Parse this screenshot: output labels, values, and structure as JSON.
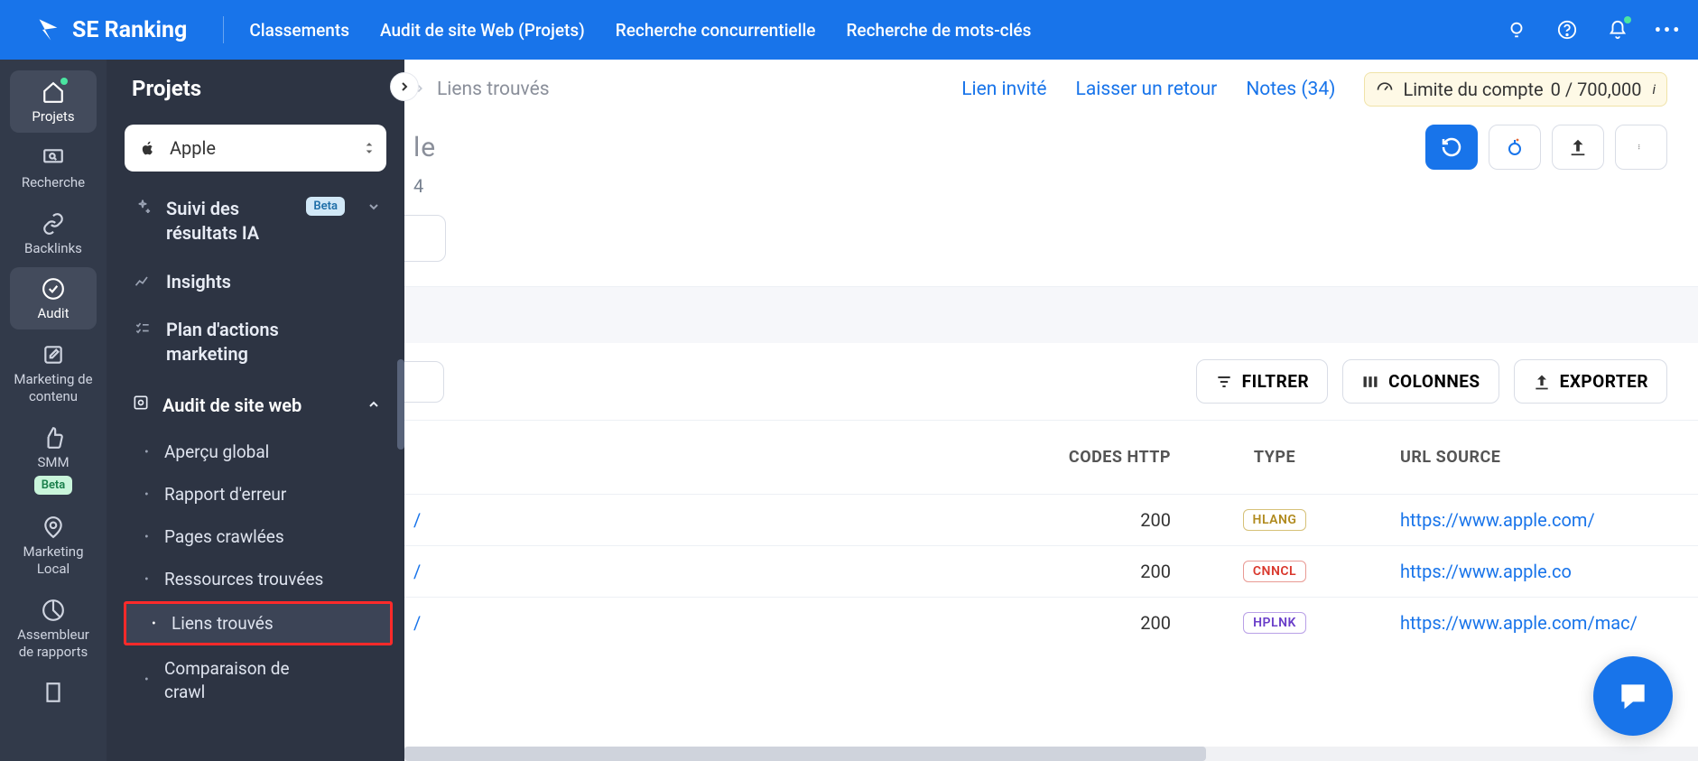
{
  "brand": "SE Ranking",
  "top_nav": {
    "items": [
      "Classements",
      "Audit de site Web (Projets)",
      "Recherche concurrentielle",
      "Recherche de mots-clés"
    ]
  },
  "icon_rail": {
    "items": [
      {
        "label": "Projets",
        "icon": "home-icon",
        "active": true,
        "green_dot": true
      },
      {
        "label": "Recherche",
        "icon": "monitor-search-icon"
      },
      {
        "label": "Backlinks",
        "icon": "link-icon"
      },
      {
        "label": "Audit",
        "icon": "check-circle-icon",
        "active": true
      },
      {
        "label": "Marketing de contenu",
        "icon": "edit-icon"
      },
      {
        "label": "SMM",
        "icon": "thumb-up-icon",
        "beta": true
      },
      {
        "label": "Marketing Local",
        "icon": "pin-icon"
      },
      {
        "label": "Assembleur de rapports",
        "icon": "pie-icon"
      }
    ],
    "beta_label": "Beta"
  },
  "side_panel": {
    "title": "Projets",
    "project_name": "Apple",
    "menu": {
      "ai_results": {
        "line1": "Suivi des",
        "line2": "résultats IA",
        "badge": "Beta"
      },
      "insights": "Insights",
      "marketing_plan": {
        "line1": "Plan d'actions",
        "line2": "marketing"
      },
      "section": "Audit de site web",
      "sub": [
        {
          "label": "Aperçu global"
        },
        {
          "label": "Rapport d'erreur"
        },
        {
          "label": "Pages crawlées"
        },
        {
          "label": "Ressources trouvées"
        },
        {
          "label": "Liens trouvés",
          "active": true,
          "highlighted": true
        },
        {
          "label": "Comparaison de crawl",
          "multi": true,
          "line1": "Comparaison de",
          "line2": "crawl"
        }
      ]
    }
  },
  "main": {
    "breadcrumb": "Liens trouvés",
    "links": {
      "guest": "Lien invité",
      "feedback": "Laisser un retour",
      "notes": "Notes (34)"
    },
    "account_limit": {
      "label": "Limite du compte",
      "value": "0 / 700,000"
    },
    "title_cut": "le",
    "date_cut": "4",
    "actions": {
      "filter": "FILTRER",
      "columns": "COLONNES",
      "export": "EXPORTER"
    },
    "table": {
      "headers": {
        "codes": "CODES HTTP",
        "type": "TYPE",
        "source": "URL SOURCE"
      },
      "rows": [
        {
          "left": "/",
          "code": "200",
          "type": "HLANG",
          "type_class": "hlang",
          "source": "https://www.apple.com/"
        },
        {
          "left": "/",
          "code": "200",
          "type": "CNNCL",
          "type_class": "cnncl",
          "source": "https://www.apple.co"
        },
        {
          "left": "/",
          "code": "200",
          "type": "HPLNK",
          "type_class": "hplnk",
          "source": "https://www.apple.com/mac/"
        }
      ]
    }
  }
}
